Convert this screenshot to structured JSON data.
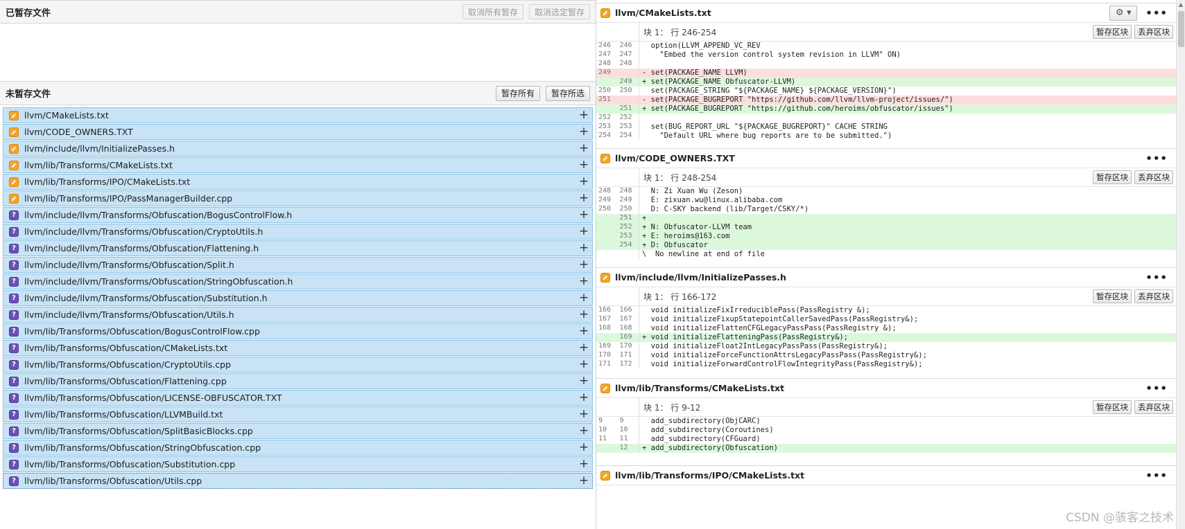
{
  "staged": {
    "title": "已暂存文件",
    "unstage_all": "取消所有暂存",
    "unstage_selected": "取消选定暂存"
  },
  "unstaged": {
    "title": "未暂存文件",
    "stage_all": "暂存所有",
    "stage_selected": "暂存所选",
    "files": [
      {
        "name": "llvm/CMakeLists.txt",
        "status": "modified"
      },
      {
        "name": "llvm/CODE_OWNERS.TXT",
        "status": "modified"
      },
      {
        "name": "llvm/include/llvm/InitializePasses.h",
        "status": "modified"
      },
      {
        "name": "llvm/lib/Transforms/CMakeLists.txt",
        "status": "modified"
      },
      {
        "name": "llvm/lib/Transforms/IPO/CMakeLists.txt",
        "status": "modified"
      },
      {
        "name": "llvm/lib/Transforms/IPO/PassManagerBuilder.cpp",
        "status": "modified"
      },
      {
        "name": "llvm/include/llvm/Transforms/Obfuscation/BogusControlFlow.h",
        "status": "untracked"
      },
      {
        "name": "llvm/include/llvm/Transforms/Obfuscation/CryptoUtils.h",
        "status": "untracked"
      },
      {
        "name": "llvm/include/llvm/Transforms/Obfuscation/Flattening.h",
        "status": "untracked"
      },
      {
        "name": "llvm/include/llvm/Transforms/Obfuscation/Split.h",
        "status": "untracked"
      },
      {
        "name": "llvm/include/llvm/Transforms/Obfuscation/StringObfuscation.h",
        "status": "untracked"
      },
      {
        "name": "llvm/include/llvm/Transforms/Obfuscation/Substitution.h",
        "status": "untracked"
      },
      {
        "name": "llvm/include/llvm/Transforms/Obfuscation/Utils.h",
        "status": "untracked"
      },
      {
        "name": "llvm/lib/Transforms/Obfuscation/BogusControlFlow.cpp",
        "status": "untracked"
      },
      {
        "name": "llvm/lib/Transforms/Obfuscation/CMakeLists.txt",
        "status": "untracked"
      },
      {
        "name": "llvm/lib/Transforms/Obfuscation/CryptoUtils.cpp",
        "status": "untracked"
      },
      {
        "name": "llvm/lib/Transforms/Obfuscation/Flattening.cpp",
        "status": "untracked"
      },
      {
        "name": "llvm/lib/Transforms/Obfuscation/LICENSE-OBFUSCATOR.TXT",
        "status": "untracked"
      },
      {
        "name": "llvm/lib/Transforms/Obfuscation/LLVMBuild.txt",
        "status": "untracked"
      },
      {
        "name": "llvm/lib/Transforms/Obfuscation/SplitBasicBlocks.cpp",
        "status": "untracked"
      },
      {
        "name": "llvm/lib/Transforms/Obfuscation/StringObfuscation.cpp",
        "status": "untracked"
      },
      {
        "name": "llvm/lib/Transforms/Obfuscation/Substitution.cpp",
        "status": "untracked"
      },
      {
        "name": "llvm/lib/Transforms/Obfuscation/Utils.cpp",
        "status": "untracked"
      }
    ]
  },
  "diff": {
    "stage_hunk": "暂存区块",
    "discard_hunk": "丢弃区块",
    "blocks": [
      {
        "file": "llvm/CMakeLists.txt",
        "hunk": "块 1： 行 246-254",
        "lines": [
          {
            "o": "246",
            "n": "246",
            "t": "ctx",
            "text": "  option(LLVM_APPEND_VC_REV"
          },
          {
            "o": "247",
            "n": "247",
            "t": "ctx",
            "text": "    \"Embed the version control system revision in LLVM\" ON)"
          },
          {
            "o": "248",
            "n": "248",
            "t": "ctx",
            "text": ""
          },
          {
            "o": "249",
            "n": "",
            "t": "del",
            "text": "- set(PACKAGE_NAME LLVM)"
          },
          {
            "o": "",
            "n": "249",
            "t": "add",
            "text": "+ set(PACKAGE_NAME Obfuscator-LLVM)"
          },
          {
            "o": "250",
            "n": "250",
            "t": "ctx",
            "text": "  set(PACKAGE_STRING \"${PACKAGE_NAME} ${PACKAGE_VERSION}\")"
          },
          {
            "o": "251",
            "n": "",
            "t": "del",
            "text": "- set(PACKAGE_BUGREPORT \"https://github.com/llvm/llvm-project/issues/\")"
          },
          {
            "o": "",
            "n": "251",
            "t": "add",
            "text": "+ set(PACKAGE_BUGREPORT \"https://github.com/heroims/obfuscator/issues\")"
          },
          {
            "o": "252",
            "n": "252",
            "t": "ctx",
            "text": ""
          },
          {
            "o": "253",
            "n": "253",
            "t": "ctx",
            "text": "  set(BUG_REPORT_URL \"${PACKAGE_BUGREPORT}\" CACHE STRING"
          },
          {
            "o": "254",
            "n": "254",
            "t": "ctx",
            "text": "    \"Default URL where bug reports are to be submitted.\")"
          }
        ]
      },
      {
        "file": "llvm/CODE_OWNERS.TXT",
        "hunk": "块 1： 行 248-254",
        "lines": [
          {
            "o": "248",
            "n": "248",
            "t": "ctx",
            "text": "  N: Zi Xuan Wu (Zeson)"
          },
          {
            "o": "249",
            "n": "249",
            "t": "ctx",
            "text": "  E: zixuan.wu@linux.alibaba.com"
          },
          {
            "o": "250",
            "n": "250",
            "t": "ctx",
            "text": "  D: C-SKY backend (lib/Target/CSKY/*)"
          },
          {
            "o": "",
            "n": "251",
            "t": "add",
            "text": "+"
          },
          {
            "o": "",
            "n": "252",
            "t": "add",
            "text": "+ N: Obfuscator-LLVM team"
          },
          {
            "o": "",
            "n": "253",
            "t": "add",
            "text": "+ E: heroims@163.com"
          },
          {
            "o": "",
            "n": "254",
            "t": "add",
            "text": "+ D: Obfuscator"
          },
          {
            "o": "",
            "n": "",
            "t": "ctx",
            "text": "\\  No newline at end of file"
          }
        ]
      },
      {
        "file": "llvm/include/llvm/InitializePasses.h",
        "hunk": "块 1： 行 166-172",
        "lines": [
          {
            "o": "166",
            "n": "166",
            "t": "ctx",
            "text": "  void initializeFixIrreduciblePass(PassRegistry &);"
          },
          {
            "o": "167",
            "n": "167",
            "t": "ctx",
            "text": "  void initializeFixupStatepointCallerSavedPass(PassRegistry&);"
          },
          {
            "o": "168",
            "n": "168",
            "t": "ctx",
            "text": "  void initializeFlattenCFGLegacyPassPass(PassRegistry &);"
          },
          {
            "o": "",
            "n": "169",
            "t": "add",
            "text": "+ void initializeFlatteningPass(PassRegistry&);"
          },
          {
            "o": "169",
            "n": "170",
            "t": "ctx",
            "text": "  void initializeFloat2IntLegacyPassPass(PassRegistry&);"
          },
          {
            "o": "170",
            "n": "171",
            "t": "ctx",
            "text": "  void initializeForceFunctionAttrsLegacyPassPass(PassRegistry&);"
          },
          {
            "o": "171",
            "n": "172",
            "t": "ctx",
            "text": "  void initializeForwardControlFlowIntegrityPass(PassRegistry&);"
          }
        ]
      },
      {
        "file": "llvm/lib/Transforms/CMakeLists.txt",
        "hunk": "块 1： 行 9-12",
        "lines": [
          {
            "o": "9",
            "n": "9",
            "t": "ctx",
            "text": "  add_subdirectory(ObjCARC)"
          },
          {
            "o": "10",
            "n": "10",
            "t": "ctx",
            "text": "  add_subdirectory(Coroutines)"
          },
          {
            "o": "11",
            "n": "11",
            "t": "ctx",
            "text": "  add_subdirectory(CFGuard)"
          },
          {
            "o": "",
            "n": "12",
            "t": "add",
            "text": "+ add_subdirectory(Obfuscation)"
          }
        ]
      },
      {
        "file": "llvm/lib/Transforms/IPO/CMakeLists.txt",
        "hunk": "",
        "lines": []
      }
    ]
  },
  "watermark": "CSDN @骇客之技术",
  "colors": {
    "modified": "#f5a622",
    "untracked": "#6b4fbb",
    "added_bg": "#dcf8dc",
    "deleted_bg": "#fcdede",
    "selected_row": "#c7e3f5"
  }
}
